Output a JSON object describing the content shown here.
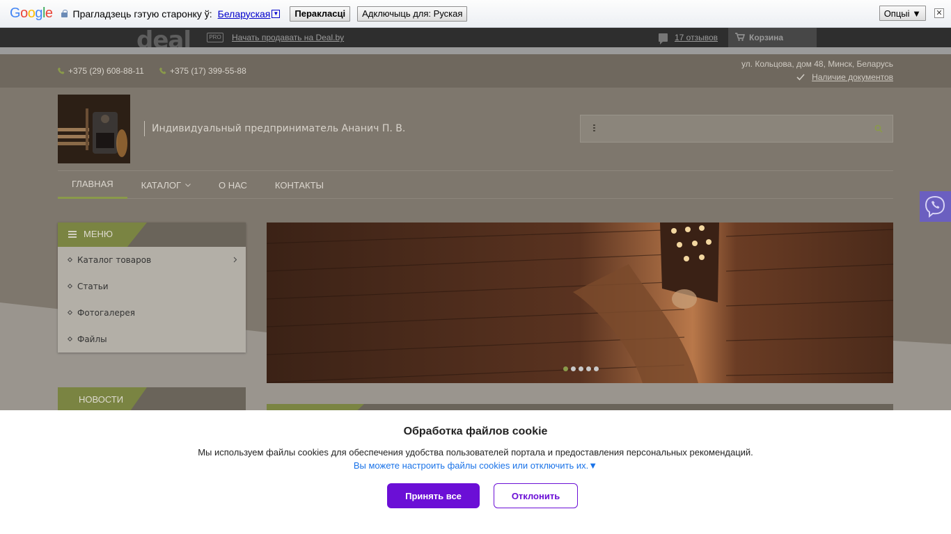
{
  "translate_bar": {
    "logo": "Google",
    "prompt": "Прагладзець гэтую старонку ў:",
    "language": "Беларуская",
    "translate_button": "Перакласці",
    "disable_button": "Адключыць для: Руская",
    "options_button": "Опцыі ▼",
    "close": "✕"
  },
  "deal_bar": {
    "logo": "deal",
    "pro_badge": "PRO",
    "sell_link": "Начать продавать на Deal.by",
    "reviews": "17 отзывов",
    "cart": "Корзина"
  },
  "contacts": {
    "phone1": "+375 (29) 608-88-11",
    "phone2": "+375 (17) 399-55-88",
    "address": "ул. Кольцова, дом 48, Минск, Беларусь",
    "documents": "Наличие документов"
  },
  "header": {
    "company": "Индивидуальный предприниматель Ананич П. В.",
    "search_placeholder": ""
  },
  "nav": {
    "items": [
      {
        "label": "Главная"
      },
      {
        "label": "Каталог"
      },
      {
        "label": "О нас"
      },
      {
        "label": "Контакты"
      }
    ]
  },
  "sidebar": {
    "menu_title": "Меню",
    "items": [
      {
        "label": "Каталог товаров"
      },
      {
        "label": "Статьи"
      },
      {
        "label": "Фотогалерея"
      },
      {
        "label": "Файлы"
      }
    ],
    "news_title": "Новости"
  },
  "slider": {
    "slides": 5,
    "active": 1
  },
  "cookie": {
    "title": "Обработка файлов cookie",
    "text": "Мы используем файлы cookies для обеспечения удобства пользователей портала и предоставления персональных рекомендаций.",
    "link": "Вы можете настроить файлы cookies или отключить их.▼",
    "accept": "Принять все",
    "decline": "Отклонить"
  },
  "colors": {
    "accent_green": "#8a9a4a",
    "cookie_purple": "#6b0fd6",
    "viber": "#6b5fc0"
  }
}
